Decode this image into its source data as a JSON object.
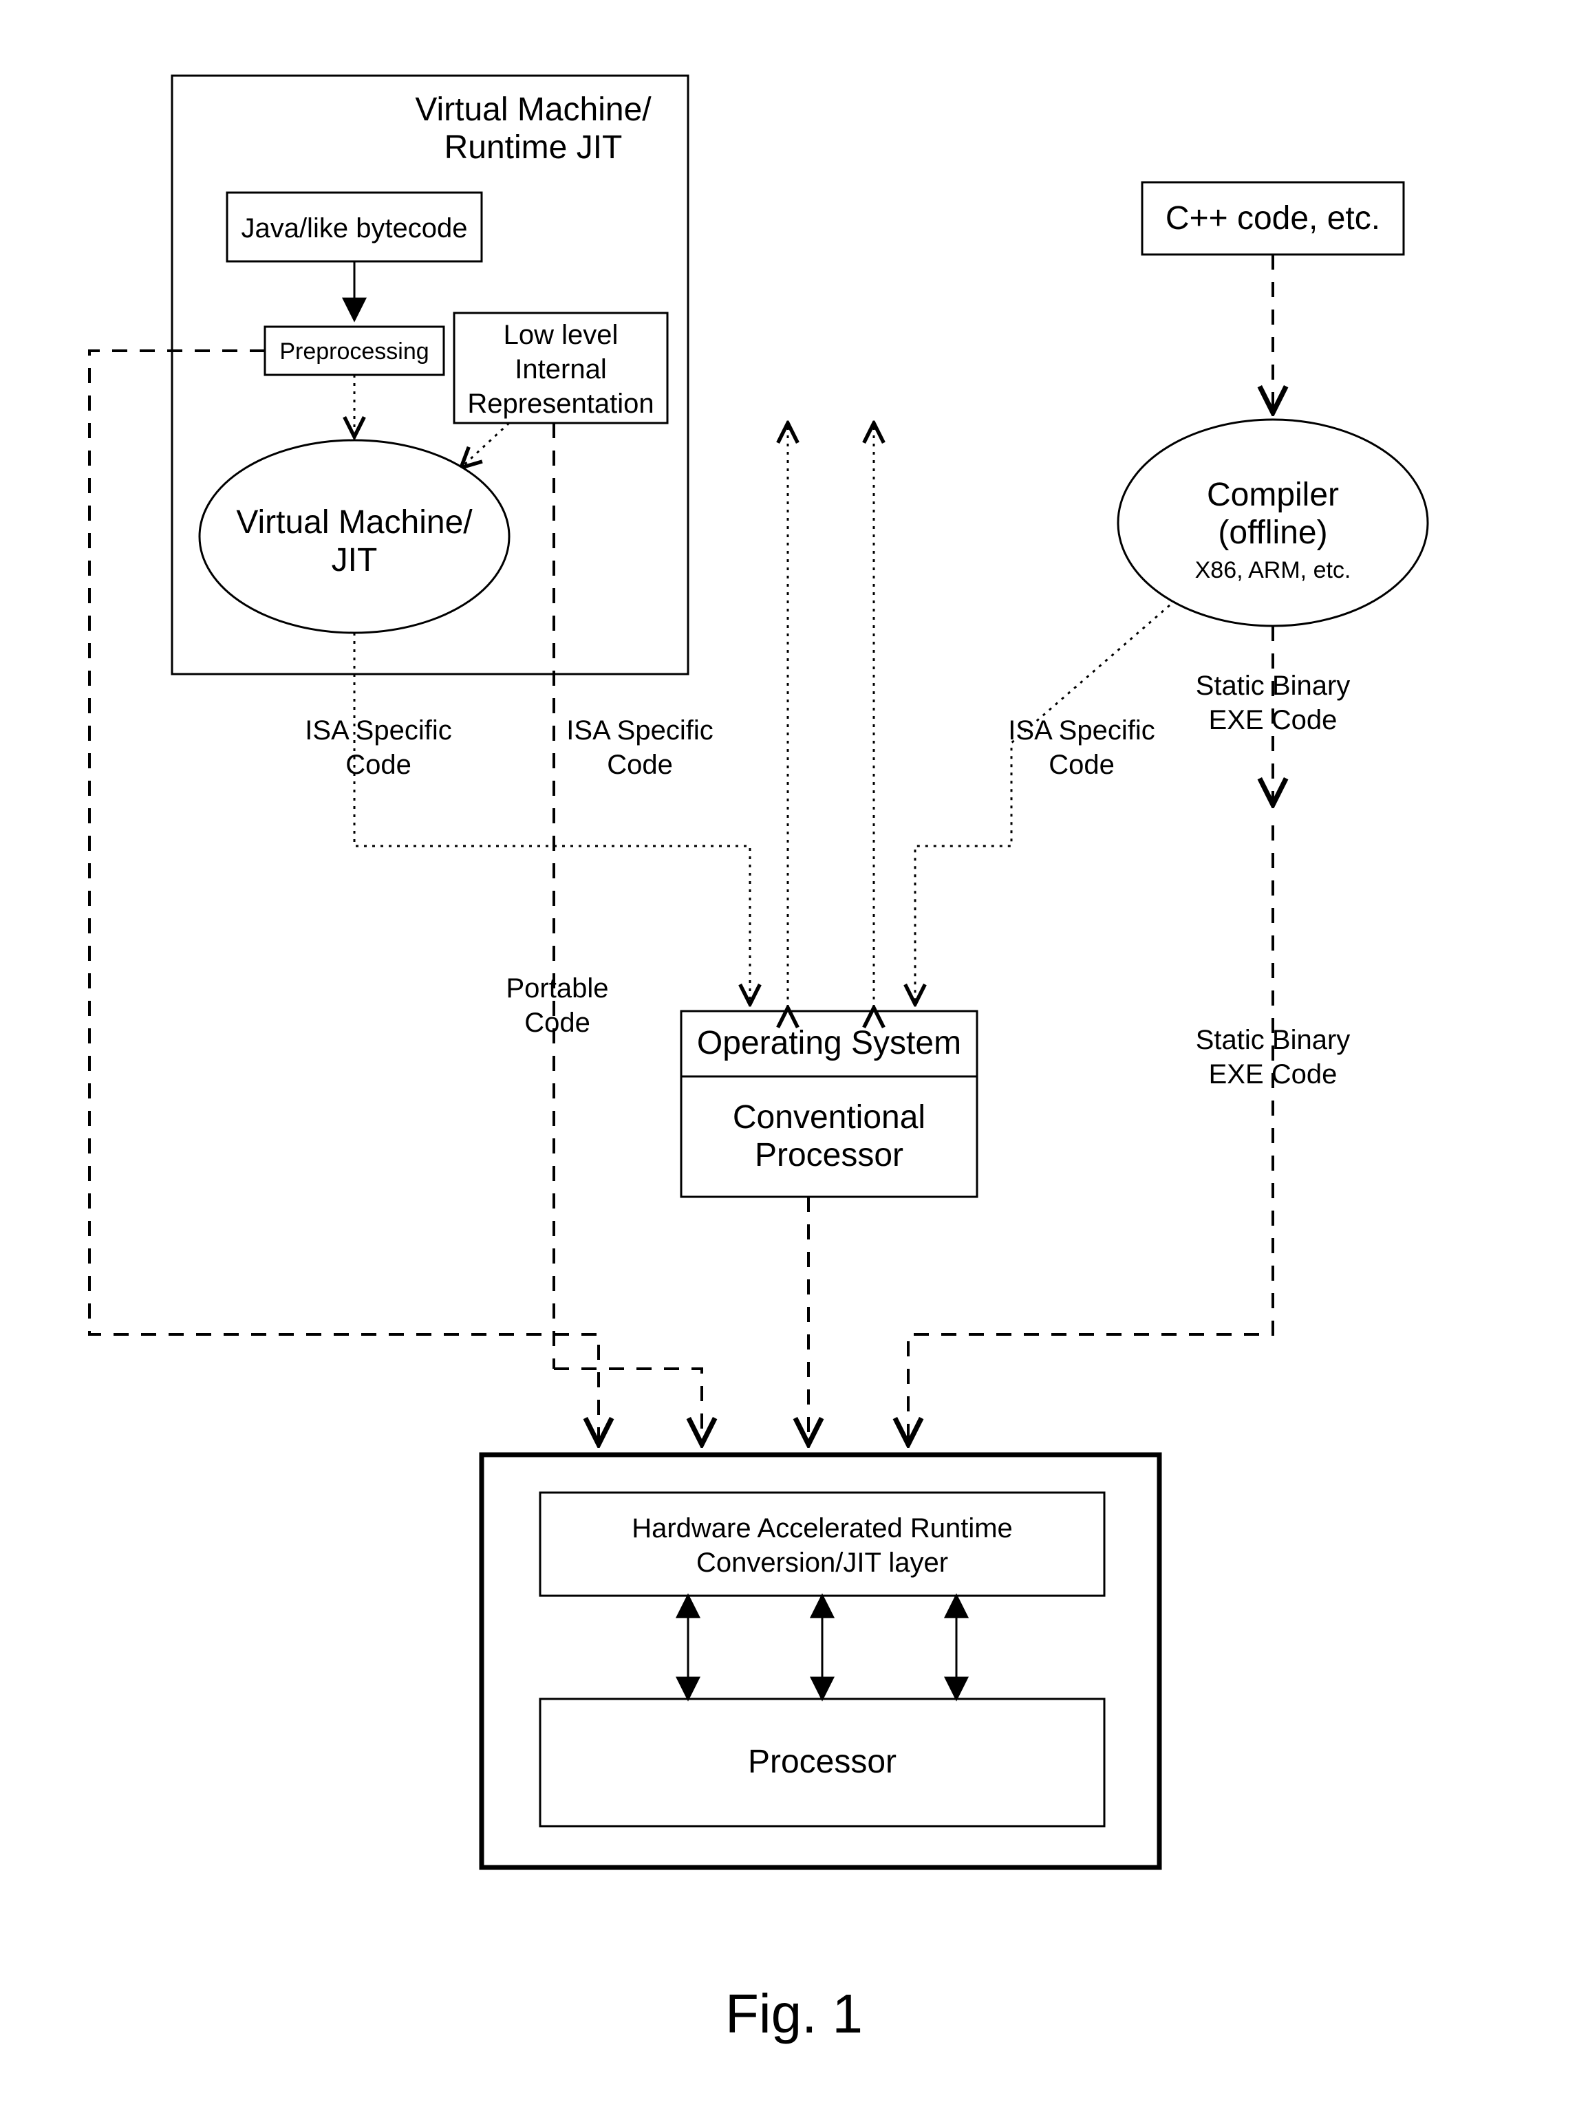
{
  "figure_label": "Fig. 1",
  "vm_box": {
    "title_line1": "Virtual Machine/",
    "title_line2": "Runtime JIT",
    "bytecode": "Java/like bytecode",
    "preprocessing": "Preprocessing",
    "lowlevel_line1": "Low level",
    "lowlevel_line2": "Internal",
    "lowlevel_line3": "Representation",
    "vm_jit_line1": "Virtual Machine/",
    "vm_jit_line2": "JIT"
  },
  "cpp_box": "C++ code, etc.",
  "compiler": {
    "line1": "Compiler",
    "line2": "(offline)",
    "line3": "X86, ARM, etc."
  },
  "edge_labels": {
    "isa_specific_line1": "ISA Specific",
    "isa_specific_line2": "Code",
    "portable_line1": "Portable",
    "portable_line2": "Code",
    "static_binary_line1": "Static Binary",
    "static_binary_line2": "EXE Code"
  },
  "os_box": {
    "os": "Operating System",
    "conv_line1": "Conventional",
    "conv_line2": "Processor"
  },
  "hw_box": {
    "jit_line1": "Hardware Accelerated Runtime",
    "jit_line2": "Conversion/JIT layer",
    "processor": "Processor"
  }
}
